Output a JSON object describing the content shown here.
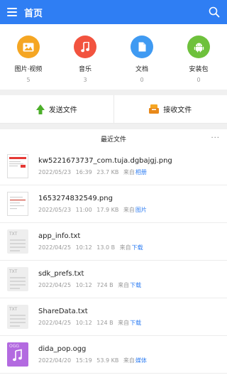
{
  "header": {
    "title": "首页"
  },
  "categories": [
    {
      "label": "图片·视频",
      "count": "5",
      "color": "#f5a623",
      "icon": "image-icon"
    },
    {
      "label": "音乐",
      "count": "3",
      "color": "#f2533f",
      "icon": "music-note-icon"
    },
    {
      "label": "文档",
      "count": "0",
      "color": "#3f9af2",
      "icon": "document-icon"
    },
    {
      "label": "安装包",
      "count": "0",
      "color": "#6ec13c",
      "icon": "android-icon"
    }
  ],
  "actions": {
    "send_label": "发送文件",
    "receive_label": "接收文件"
  },
  "recent": {
    "title": "最近文件",
    "more": "···",
    "files": [
      {
        "name": "kw5221673737_com.tuja.dgbajgj.png",
        "date": "2022/05/23",
        "time": "16:39",
        "size": "23.7 KB",
        "from": "来自",
        "source": "相册",
        "type": "image"
      },
      {
        "name": "1653274832549.png",
        "date": "2022/05/23",
        "time": "11:00",
        "size": "17.9 KB",
        "from": "来自",
        "source": "图片",
        "type": "image"
      },
      {
        "name": "app_info.txt",
        "date": "2022/04/25",
        "time": "10:12",
        "size": "13.0 B",
        "from": "来自",
        "source": "下载",
        "type": "txt",
        "thumb_label": "TXT"
      },
      {
        "name": "sdk_prefs.txt",
        "date": "2022/04/25",
        "time": "10:12",
        "size": "724 B",
        "from": "来自",
        "source": "下载",
        "type": "txt",
        "thumb_label": "TXT"
      },
      {
        "name": "ShareData.txt",
        "date": "2022/04/25",
        "time": "10:12",
        "size": "124 B",
        "from": "来自",
        "source": "下载",
        "type": "txt",
        "thumb_label": "TXT"
      },
      {
        "name": "dida_pop.ogg",
        "date": "2022/04/20",
        "time": "15:19",
        "size": "53.9 KB",
        "from": "来自",
        "source": "媒体",
        "type": "ogg",
        "thumb_label": "OGG"
      }
    ]
  }
}
